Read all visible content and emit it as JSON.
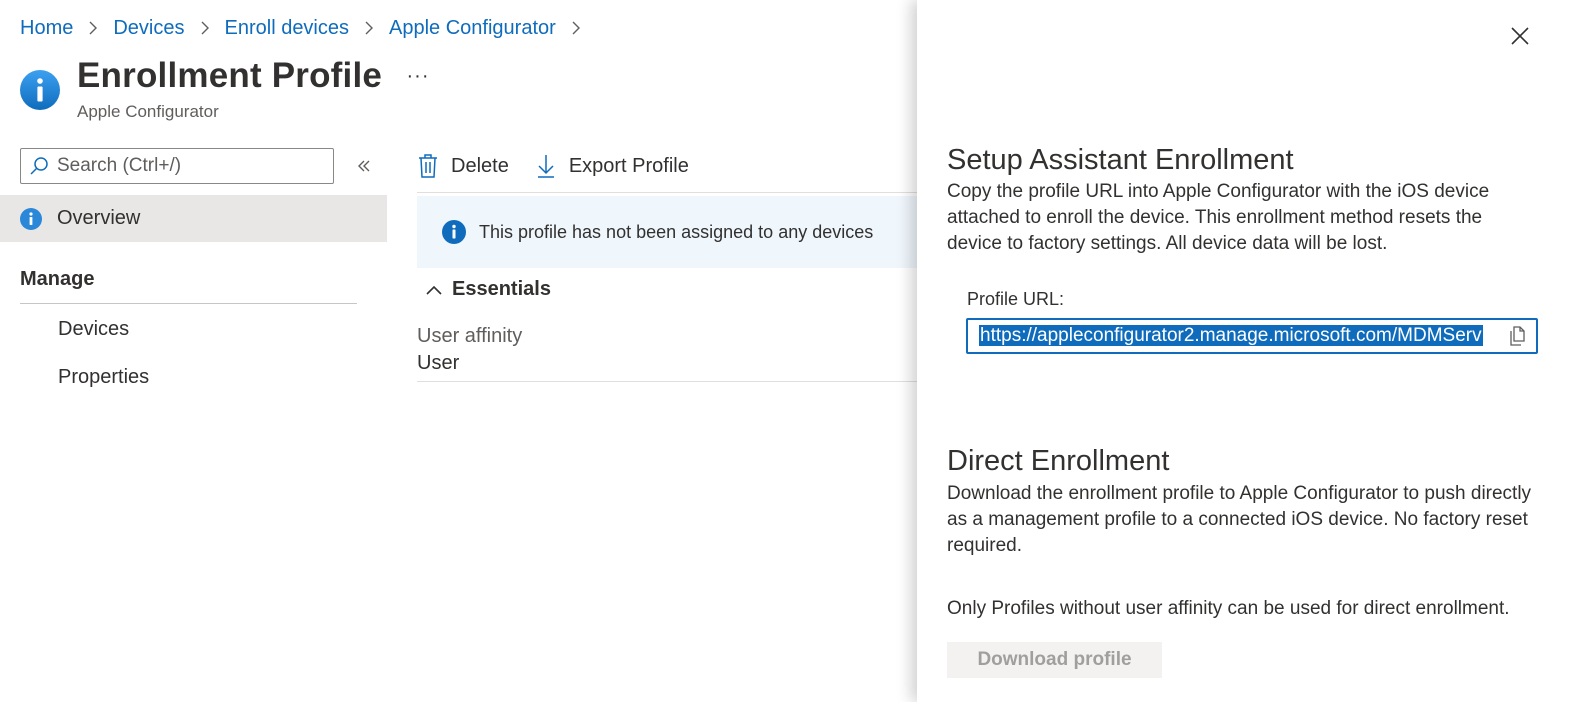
{
  "breadcrumb": [
    {
      "label": "Home"
    },
    {
      "label": "Devices"
    },
    {
      "label": "Enroll devices"
    },
    {
      "label": "Apple Configurator"
    }
  ],
  "header": {
    "title": "Enrollment Profile",
    "subtitle": "Apple Configurator",
    "more": "···"
  },
  "nav": {
    "search_placeholder": "Search (Ctrl+/)",
    "overview": "Overview",
    "section": "Manage",
    "items": [
      {
        "label": "Devices"
      },
      {
        "label": "Properties"
      }
    ]
  },
  "toolbar": {
    "delete": "Delete",
    "export": "Export Profile"
  },
  "banner": {
    "text": "This profile has not been assigned to any devices"
  },
  "essentials": {
    "heading": "Essentials",
    "field_label": "User affinity",
    "field_value": "User"
  },
  "panel": {
    "setup_title": "Setup Assistant Enrollment",
    "setup_desc": "Copy the profile URL into Apple Configurator with the iOS device attached to enroll the device. This enrollment method resets the device to factory settings. All device data will be lost.",
    "url_label": "Profile URL:",
    "url_value": "https://appleconfigurator2.manage.microsoft.com/MDMServ",
    "direct_title": "Direct Enrollment",
    "direct_desc": "Download the enrollment profile to Apple Configurator to push directly as a management profile to a connected iOS device. No factory reset required.",
    "note": "Only Profiles without user affinity can be used for direct enrollment.",
    "download_label": "Download profile"
  },
  "colors": {
    "accent": "#0f6cbd",
    "banner_bg": "#eff6fc",
    "selected_nav_bg": "#e8e7e6",
    "disabled_text": "#a19f9d"
  }
}
